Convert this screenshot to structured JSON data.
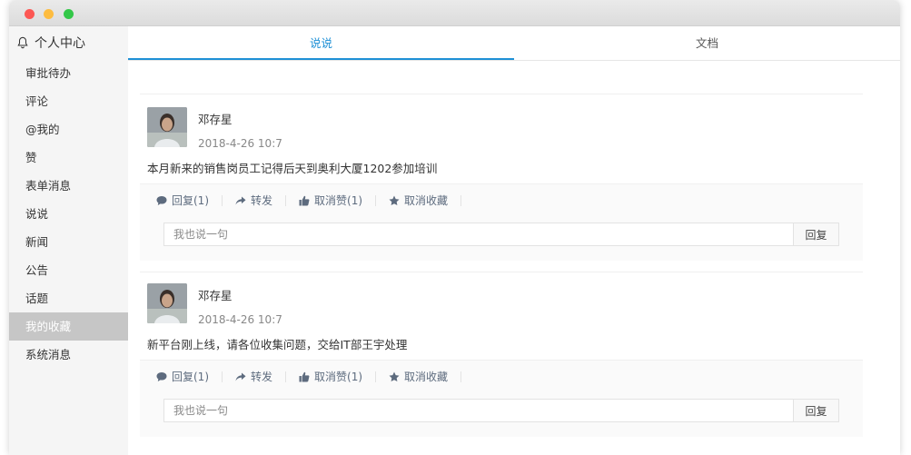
{
  "sidebar": {
    "title": "个人中心",
    "items": [
      {
        "label": "审批待办"
      },
      {
        "label": "评论"
      },
      {
        "label": "@我的"
      },
      {
        "label": "赞"
      },
      {
        "label": "表单消息"
      },
      {
        "label": "说说"
      },
      {
        "label": "新闻"
      },
      {
        "label": "公告"
      },
      {
        "label": "话题"
      },
      {
        "label": "我的收藏",
        "active": true
      },
      {
        "label": "系统消息"
      }
    ]
  },
  "tabs": [
    {
      "label": "说说",
      "active": true
    },
    {
      "label": "文档"
    }
  ],
  "posts": [
    {
      "author": "邓存星",
      "time": "2018-4-26 10:7",
      "content": "本月新来的销售岗员工记得后天到奥利大厦1202参加培训",
      "actions": {
        "reply": "回复(1)",
        "forward": "转发",
        "unlike": "取消赞(1)",
        "unfavorite": "取消收藏"
      },
      "reply_placeholder": "我也说一句",
      "reply_button": "回复"
    },
    {
      "author": "邓存星",
      "time": "2018-4-26 10:7",
      "content": "新平台刚上线，请各位收集问题，交给IT部王宇处理",
      "actions": {
        "reply": "回复(1)",
        "forward": "转发",
        "unlike": "取消赞(1)",
        "unfavorite": "取消收藏"
      },
      "reply_placeholder": "我也说一句",
      "reply_button": "回复"
    }
  ],
  "colors": {
    "accent": "#1e90d6",
    "sidebar_active": "#c6c6c6",
    "action_text": "#5d6b7e"
  }
}
